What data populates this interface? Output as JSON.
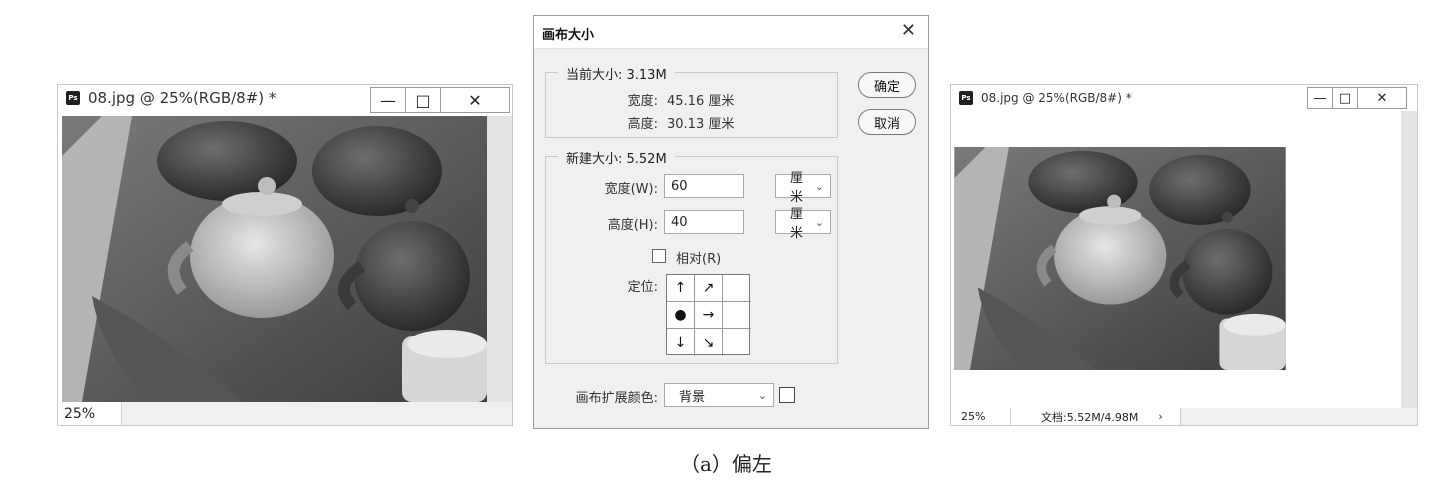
{
  "left_window": {
    "title": "08.jpg @ 25%(RGB/8#) *",
    "app_badge": "Ps",
    "zoom": "25%",
    "buttons": {
      "minimize": "—",
      "maximize": "□",
      "close": "✕"
    }
  },
  "dialog": {
    "title": "画布大小",
    "close": "✕",
    "current_size": {
      "legend": "当前大小: 3.13M",
      "width_label": "宽度:",
      "width_value": "45.16 厘米",
      "height_label": "高度:",
      "height_value": "30.13 厘米"
    },
    "new_size": {
      "legend": "新建大小: 5.52M",
      "width_label": "宽度(W):",
      "width_value": "60",
      "width_unit": "厘米",
      "height_label": "高度(H):",
      "height_value": "40",
      "height_unit": "厘米",
      "relative_label": "相对(R)",
      "relative_checked": false,
      "anchor_label": "定位:",
      "anchor_cells": [
        "↑",
        "↗",
        "",
        "●",
        "→",
        "",
        "↓",
        "↘",
        ""
      ]
    },
    "extension_color_label": "画布扩展颜色:",
    "extension_color_value": "背景",
    "extension_swatch": "#ffffff",
    "ok_label": "确定",
    "cancel_label": "取消"
  },
  "right_window": {
    "title": "08.jpg @ 25%(RGB/8#) *",
    "app_badge": "Ps",
    "zoom": "25%",
    "doc_info": "文档:5.52M/4.98M",
    "arrow": "›",
    "buttons": {
      "minimize": "—",
      "maximize": "□",
      "close": "✕"
    }
  },
  "caption": "（a）偏左"
}
